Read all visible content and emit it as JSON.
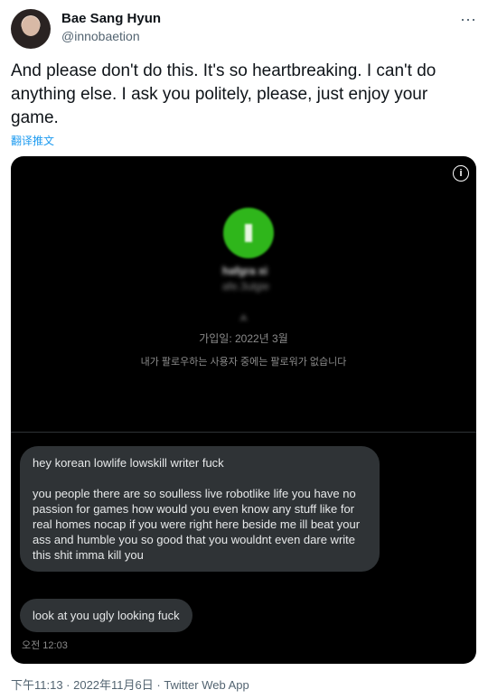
{
  "user": {
    "name": "Bae Sang Hyun",
    "handle": "@innobaetion"
  },
  "tweet": {
    "text": "And please don't do this. It's so heartbreaking. I can't do anything else. I ask you politely, please, just enjoy your game.",
    "translate_label": "翻译推文"
  },
  "media": {
    "profile_name": "hafgra xi",
    "profile_handle": "afe.3ulgie",
    "profile_bio": "ㅅ",
    "joined": "가입일: 2022년 3월",
    "follow_note": "내가 팔로우하는 사용자 중에는 팔로워가 없습니다",
    "messages": [
      "hey korean lowlife lowskill writer fuck",
      "you people there are so soulless live robotlike life you have no passion for games how would you even know any stuff like for real homes nocap if you were right here beside me ill beat your ass and humble you so good that you wouldnt even dare write this shit imma kill you",
      "look at you ugly looking fuck"
    ],
    "message_time": "오전 12:03"
  },
  "footer": {
    "meta": "下午11:13 · 2022年11月6日 · Twitter Web App"
  },
  "colors": {
    "link": "#1d9bf0",
    "media_bg": "#000000",
    "bubble": "#2f3336"
  },
  "icons": {
    "more": "more-dots-icon",
    "info": "info-icon"
  }
}
